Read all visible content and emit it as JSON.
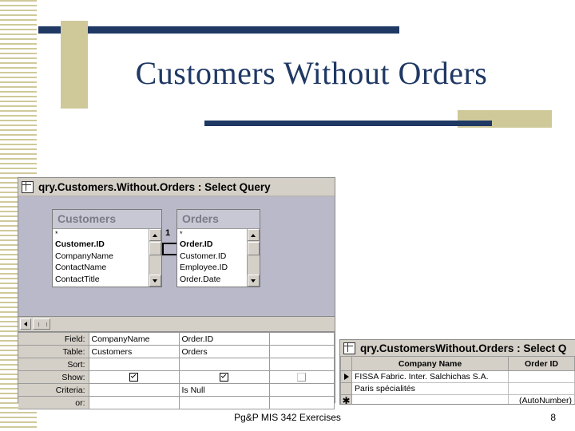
{
  "slide": {
    "title": "Customers Without Orders",
    "footer_text": "Pg&P MIS 342 Exercises",
    "page_number": "8",
    "accent_navy": "#1f3864",
    "accent_gold": "#cfc99a"
  },
  "query_window": {
    "title": "qry.Customers.Without.Orders : Select Query",
    "title_icon": "query-design-icon",
    "tables": [
      {
        "name": "Customers",
        "fields": [
          "*",
          "Customer.ID",
          "CompanyName",
          "ContactName",
          "ContactTitle"
        ]
      },
      {
        "name": "Orders",
        "fields": [
          "*",
          "Order.ID",
          "Customer.ID",
          "Employee.ID",
          "Order.Date"
        ]
      }
    ],
    "join": {
      "left_label": "1",
      "right_label": "∞"
    },
    "grid": {
      "row_labels": [
        "Field:",
        "Table:",
        "Sort:",
        "Show:",
        "Criteria:",
        "or:"
      ],
      "columns": [
        {
          "field": "CompanyName",
          "table": "Customers",
          "sort": "",
          "show": true,
          "criteria": "",
          "or": ""
        },
        {
          "field": "Order.ID",
          "table": "Orders",
          "sort": "",
          "show": true,
          "criteria": "Is Null",
          "or": ""
        },
        {
          "field": "",
          "table": "",
          "sort": "",
          "show": false,
          "criteria": "",
          "or": ""
        }
      ]
    }
  },
  "datasheet_window": {
    "title": "qry.CustomersWithout.Orders : Select Q",
    "title_icon": "datasheet-icon",
    "headers": [
      "Company Name",
      "Order ID"
    ],
    "rows": [
      {
        "marker": "current-record-arrow",
        "company": "FISSA Fabric. Inter. Salchichas S.A.",
        "order_id": ""
      },
      {
        "marker": "",
        "company": "Paris spécialités",
        "order_id": ""
      },
      {
        "marker": "new-record-star",
        "company": "",
        "order_id": "(AutoNumber)"
      }
    ]
  }
}
